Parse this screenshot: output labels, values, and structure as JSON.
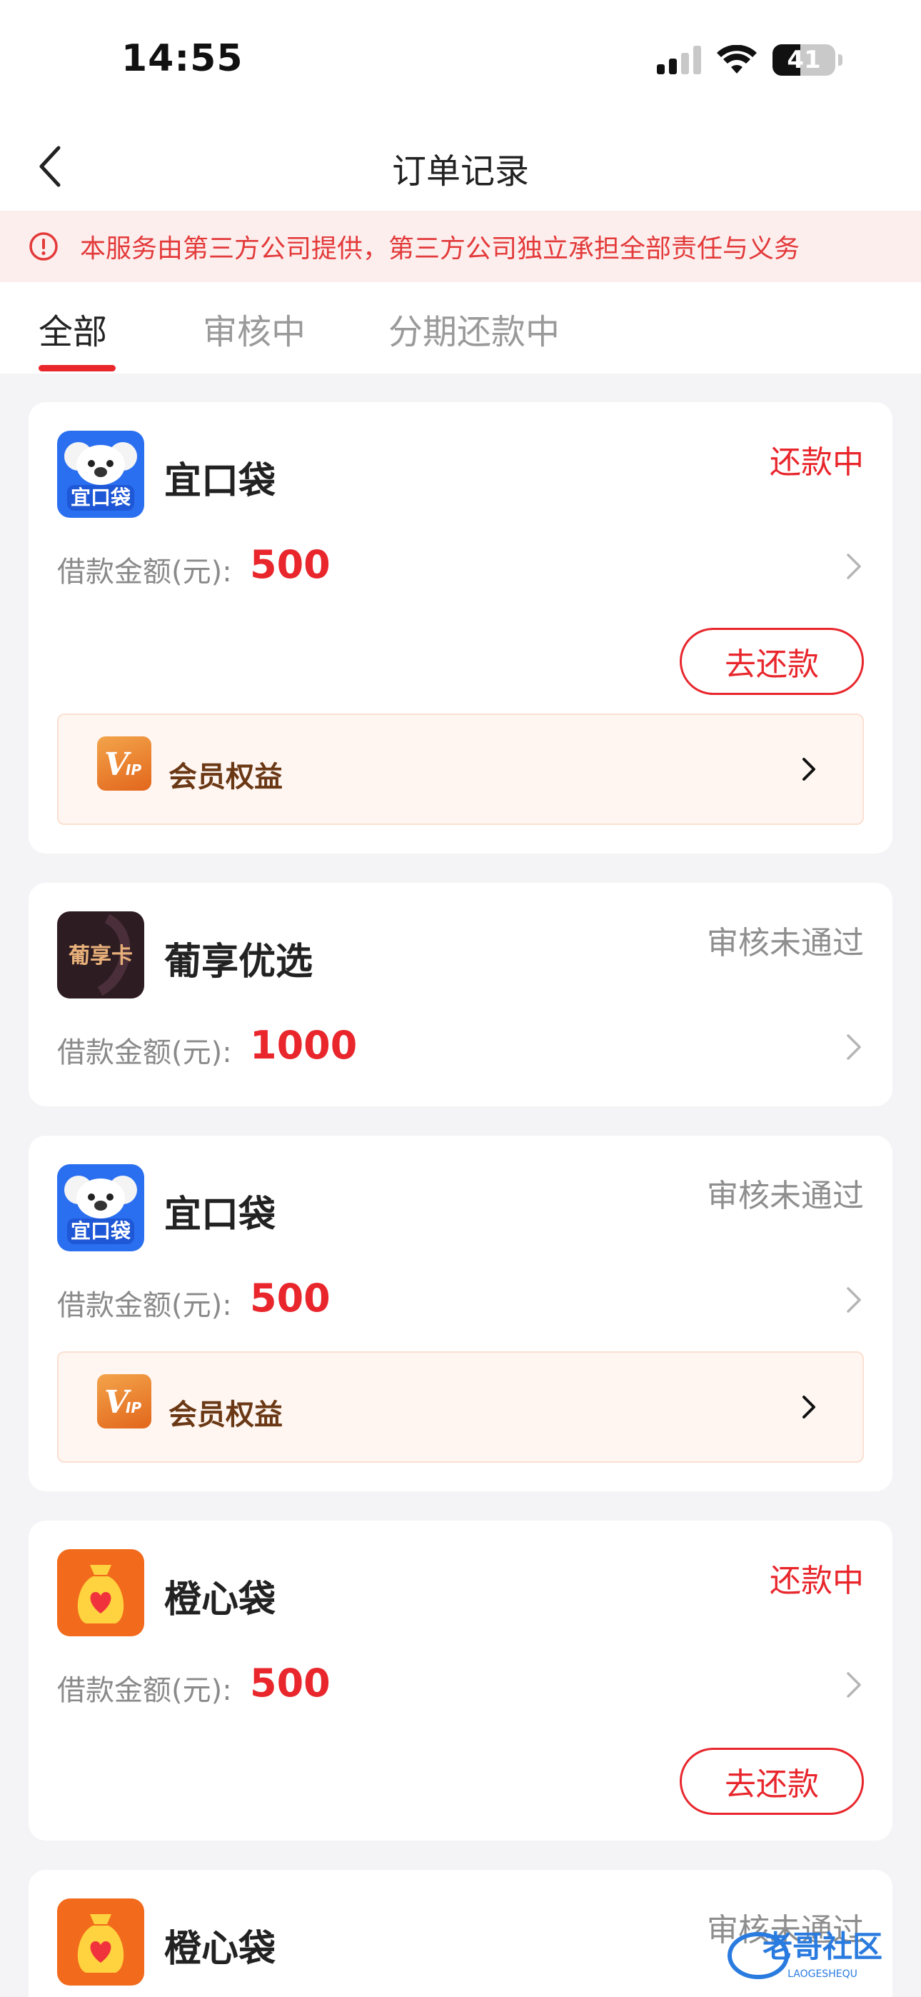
{
  "status_bar": {
    "time": "14:55",
    "battery": "41"
  },
  "nav": {
    "title": "订单记录"
  },
  "notice": {
    "text": "本服务由第三方公司提供，第三方公司独立承担全部责任与义务"
  },
  "tabs": [
    {
      "label": "全部",
      "active": true
    },
    {
      "label": "审核中",
      "active": false
    },
    {
      "label": "分期还款中",
      "active": false
    }
  ],
  "orders": [
    {
      "app_name": "宜口袋",
      "icon": "koala-icon",
      "icon_text": "宜口袋",
      "status": "还款中",
      "status_color": "#e8262c",
      "amount_label": "借款金额(元):",
      "amount": "500",
      "repay_label": "去还款",
      "vip_label": "会员权益"
    },
    {
      "app_name": "葡享优选",
      "icon": "grape-card-icon",
      "icon_text": "葡享卡",
      "status": "审核未通过",
      "status_color": "#8e8e8e",
      "amount_label": "借款金额(元):",
      "amount": "1000"
    },
    {
      "app_name": "宜口袋",
      "icon": "koala-icon",
      "icon_text": "宜口袋",
      "status": "审核未通过",
      "status_color": "#8e8e8e",
      "amount_label": "借款金额(元):",
      "amount": "500",
      "vip_label": "会员权益"
    },
    {
      "app_name": "橙心袋",
      "icon": "money-bag-heart-icon",
      "status": "还款中",
      "status_color": "#e8262c",
      "amount_label": "借款金额(元):",
      "amount": "500",
      "repay_label": "去还款"
    },
    {
      "app_name": "橙心袋",
      "icon": "money-bag-heart-icon",
      "status": "审核未通过",
      "status_color": "#8e8e8e"
    }
  ],
  "watermark": {
    "text": "老哥社区",
    "subtext": "LAOGESHEQU"
  },
  "colors": {
    "accent": "#e8262c",
    "notice_bg": "#fdeeee",
    "vip_bg": "#fff6f1",
    "page_bg": "#f4f4f6"
  }
}
